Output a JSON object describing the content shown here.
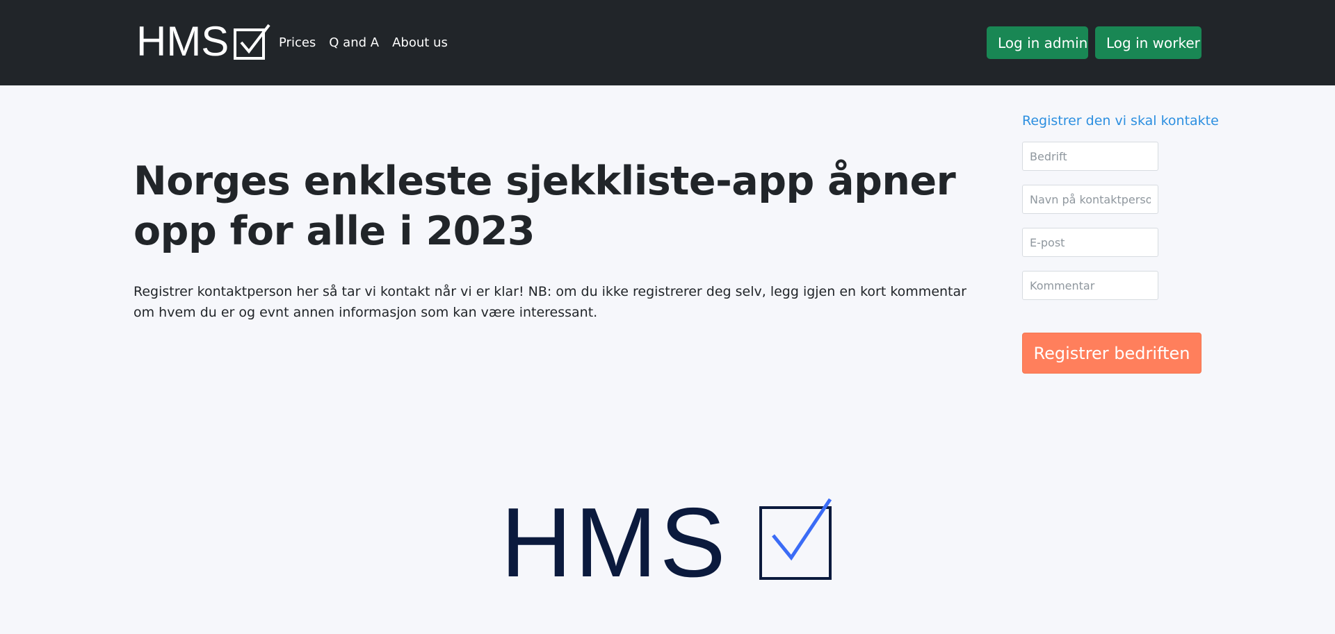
{
  "navbar": {
    "brand_text": "HMS",
    "brand_icon": "checkbox-check-icon",
    "links": [
      "Prices",
      "Q and A",
      "About us"
    ],
    "login_admin_label": "Log in admin",
    "login_worker_label": "Log in worker",
    "background_color": "#212529",
    "button_color": "#198754"
  },
  "hero": {
    "title": "Norges enkleste sjekkliste-app åpner opp for alle i 2023",
    "description": "Registrer kontaktperson her så tar vi kontakt når vi er klar! NB: om du ikke registrerer deg selv, legg igjen en kort kommentar om hvem du er og evnt annen informasjon som kan være interessant."
  },
  "contact_form": {
    "title": "Registrer den vi skal kontakte",
    "fields": [
      {
        "placeholder": "Bedrift",
        "value": ""
      },
      {
        "placeholder": "Navn på kontaktperson",
        "value": ""
      },
      {
        "placeholder": "E-post",
        "value": ""
      },
      {
        "placeholder": "Kommentar",
        "value": ""
      }
    ],
    "submit_label": "Registrer bedriften",
    "title_color": "#2c8fe0",
    "submit_color": "#ff7f5c"
  },
  "footer_logo": {
    "text": "HMS",
    "icon": "checkbox-check-icon",
    "text_color": "#0b1a3d",
    "check_color": "#3b6cf6"
  }
}
